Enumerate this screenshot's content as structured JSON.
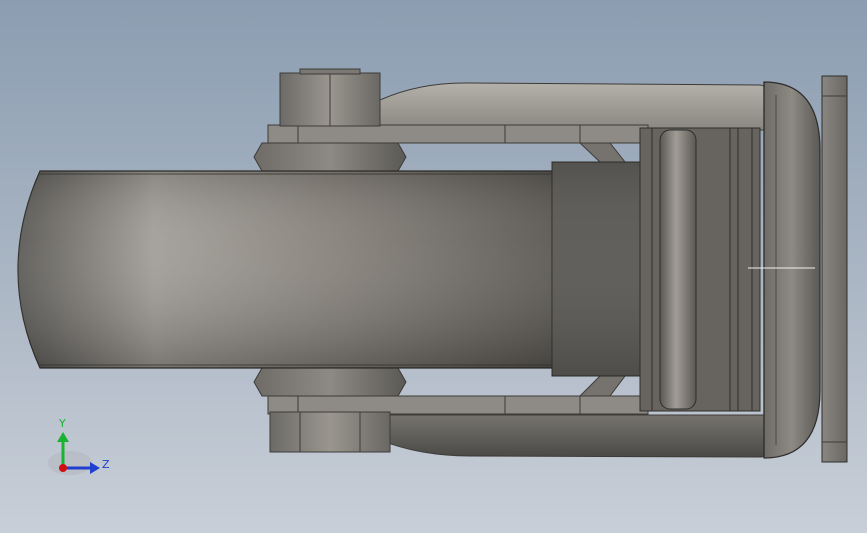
{
  "viewport": {
    "background_top": "#8b9db1",
    "background_bottom": "#c9cfd8",
    "part_color": "#8c8a85"
  },
  "triad": {
    "y_label": "Y",
    "z_label": "Z",
    "y_color": "#19b233",
    "z_color": "#1f3fcf",
    "x_color": "#d01010"
  }
}
